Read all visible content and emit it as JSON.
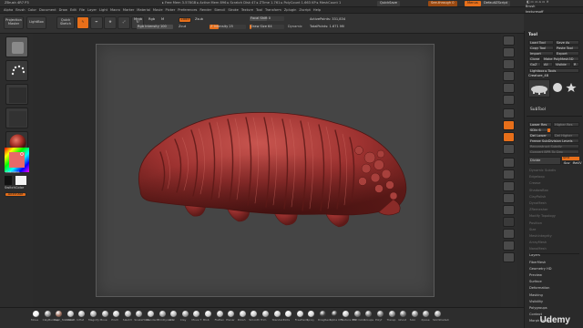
{
  "app": {
    "title": "ZBrush 4R7 P3",
    "stats": "▸ Free Mem 3.578GB ▸ Active Mem 896 ▸ Scratch Disk 47 ▸ ZTime 1.761 ▸ PolyCount 1.663 KP ▸ MeshCount 1",
    "quicksave": "QuickSave",
    "see_through_label": "See-through",
    "see_through_value": "0",
    "menus_label": "Menus",
    "default_zscript": "DefaultZScript"
  },
  "menubar": [
    "Alpha",
    "Brush",
    "Color",
    "Document",
    "Draw",
    "Edit",
    "File",
    "Layer",
    "Light",
    "Macro",
    "Marker",
    "Material",
    "Movie",
    "Picker",
    "Preferences",
    "Render",
    "Stencil",
    "Stroke",
    "Texture",
    "Tool",
    "Transform",
    "Zplugin",
    "Zscript",
    "Help"
  ],
  "topshelf": {
    "projection_master": "Projection Master",
    "lightbox": "LightBox",
    "quick_sketch": "Quick Sketch",
    "edit": "Edit",
    "draw": "Draw",
    "move": "Move",
    "scale": "Scale",
    "rotate": "Rotate",
    "mrgb": "Mrgb",
    "rgb": "Rgb",
    "m": "M",
    "zadd": "Zadd",
    "zsub": "Zsub",
    "zcut": "Zcut",
    "rgb_intensity": "Rgb Intensity 100",
    "z_intensity": "Z Intensity 25",
    "focal_shift": "Focal Shift 0",
    "draw_size": "Draw Size 64",
    "dynamic": "Dynamic",
    "active_points": "ActivePoints: 331,834",
    "total_points": "TotalPoints: 1.671 Mil"
  },
  "lefttray": {
    "gradient": "Gradient",
    "switch_color": "SwitchColor",
    "alternate": "Alternate"
  },
  "rightpanel": {
    "tool_title": "Tool",
    "brush_label": "Brush",
    "brush_name": "texturesoff",
    "load_tool": "Load Tool",
    "save_as": "Save As",
    "copy_tool": "Copy Tool",
    "paste_tool": "Paste Tool",
    "import": "Import",
    "export": "Export",
    "clone": "Clone",
    "make_polymesh3d": "Make PolyMesh3D",
    "goz": "GoZ",
    "all": "All",
    "visible": "Visible",
    "r": "R",
    "lightbox_tools": "Lightbox ▸ Tools",
    "current_tool": "Creature_48",
    "subtool": "SubTool",
    "lower_res": "Lower Res",
    "higher_res": "Higher Res",
    "sdiv": "SDiv 6",
    "del_lower": "Del Lower",
    "del_higher": "Del Higher",
    "freeze_subdivision": "Freeze SubDivision Levels",
    "reconstruct_subdiv": "Reconstruct Subdiv",
    "convert_bpr": "Convert BPR To Geo",
    "divide": "Divide",
    "smt": "Smt",
    "suv": "Suv",
    "reuv": "ReUV",
    "sections": [
      "Dynamic Subdiv",
      "Edgeloop",
      "Crease",
      "ShadowBox",
      "ClayPolish",
      "DynaMesh",
      "ZRemesher",
      "Modify Topology",
      "Position",
      "Size",
      "MeshIntegrity",
      "ArrayMesh",
      "NanoMesh",
      "Layers",
      "FiberMesh",
      "Geometry HD",
      "Preview",
      "Surface",
      "Deformation",
      "Masking",
      "Visibility",
      "Polygroups",
      "Contact",
      "Morph Target"
    ]
  },
  "bottombar": {
    "items": [
      "Move",
      "ClayBuildup",
      "Dam_Standard",
      "hPolish",
      "Inflat",
      "Magnify",
      "Move",
      "Pinch",
      "Slash3",
      "SnakeHook",
      "Standard",
      "TrimDynamic",
      "Orb",
      "Clay",
      "Move T",
      "Blob",
      "Flatten",
      "Planar",
      "Polish",
      "Smooth",
      "Trim",
      "Standard",
      "Dots",
      "FreeHand",
      "Spray",
      "DragRect",
      "Alpha Off",
      "Texture Off",
      "Flat Color",
      "Groups",
      "Polyf",
      "Transp",
      "Ghost",
      "Solo",
      "Xpose",
      "SkinShade4"
    ]
  },
  "watermark": "Udemy",
  "colors": {
    "accent": "#e76f1a",
    "creature": "#a83a3a",
    "canvas": "#454545"
  }
}
